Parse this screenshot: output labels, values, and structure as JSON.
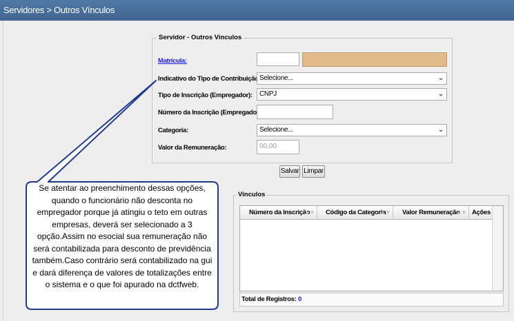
{
  "header": {
    "title": "Servidores > Outros Vínculos"
  },
  "form": {
    "legend": "Servidor - Outros Vinculos",
    "matricula_label": "Matrícula:",
    "matricula_value": "",
    "tipo_contribuicao_label": "Indicativo do Tipo de Contribuição:",
    "tipo_contribuicao_value": "Selecione...",
    "tipo_inscricao_label": "Tipo de Inscrição (Empregador):",
    "tipo_inscricao_value": "CNPJ",
    "numero_inscricao_label": "Número da Inscrição (Empregador):",
    "numero_inscricao_value": "",
    "categoria_label": "Categoria:",
    "categoria_value": "Selecione...",
    "valor_label": "Valor da Remuneração:",
    "valor_placeholder": "00,00"
  },
  "buttons": {
    "save": "Salvar",
    "clear": "Limpar"
  },
  "vinculos": {
    "legend": "Vinculos",
    "columns": [
      "Número da Inscrição",
      "Código da Categoria",
      "Valor Remuneração",
      "Ações"
    ],
    "rows": [],
    "total_label": "Total de Registros:",
    "total_count": "0"
  },
  "callout": {
    "text": "Se atentar ao preenchimento dessas opções, quando o funcionário não desconta no empregador porque já atingiu o teto em outras empresas, deverá ser selecionado a 3 opção.Assim no esocial sua remuneração não será contabilizada para desconto de previdência também.Caso contrário será contabilizado na gui e dará diferença de valores de totalizações entre o sistema e o que foi apurado na dctfweb."
  },
  "icons": {
    "dropdown": "chevron-down-icon",
    "sort": "sort-icon"
  },
  "colors": {
    "header_bg": "#4a709c",
    "readonly_field": "#e2bb8b",
    "link": "#1a1aee",
    "callout_border": "#1f3a93"
  }
}
